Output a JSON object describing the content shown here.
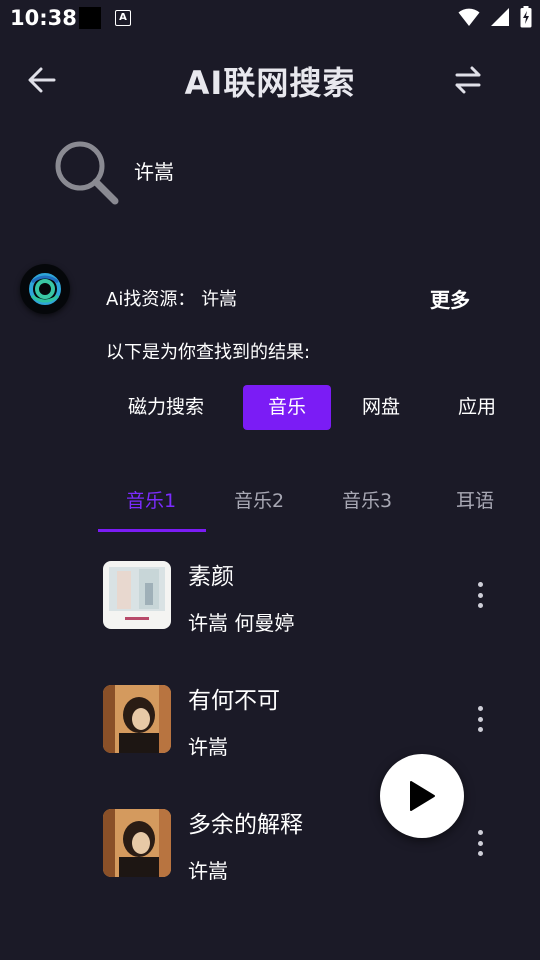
{
  "status_bar": {
    "time": "10:38",
    "a_badge": "A",
    "icons": [
      "wifi-icon",
      "signal-icon",
      "battery-charging-icon"
    ]
  },
  "header": {
    "title": "AI联网搜索",
    "back_icon": "arrow-left-icon",
    "switch_icon": "swap-arrows-icon"
  },
  "search": {
    "value": "许嵩",
    "icon": "search-icon"
  },
  "ai": {
    "query_label": "Ai找资源：",
    "query_value": "许嵩",
    "more_label": "更多",
    "result_intro": "以下是为你查找到的结果:"
  },
  "categories": [
    {
      "label": "磁力搜索",
      "active": false
    },
    {
      "label": "音乐",
      "active": true
    },
    {
      "label": "网盘",
      "active": false
    },
    {
      "label": "应用",
      "active": false
    }
  ],
  "tabs": [
    {
      "label": "音乐1",
      "active": true
    },
    {
      "label": "音乐2",
      "active": false
    },
    {
      "label": "音乐3",
      "active": false
    },
    {
      "label": "耳语",
      "active": false
    }
  ],
  "songs": [
    {
      "title": "素颜",
      "artist": "许嵩 何曼婷",
      "cover": "cover-light"
    },
    {
      "title": "有何不可",
      "artist": "许嵩",
      "cover": "cover-dark"
    },
    {
      "title": "多余的解释",
      "artist": "许嵩",
      "cover": "cover-dark"
    }
  ],
  "player": {
    "icon": "play-icon"
  },
  "colors": {
    "background": "#1b1a27",
    "accent": "#7b1cf5",
    "tab_active": "#7b2cff",
    "text": "#ffffff",
    "tab_inactive": "#a8a8b4"
  }
}
